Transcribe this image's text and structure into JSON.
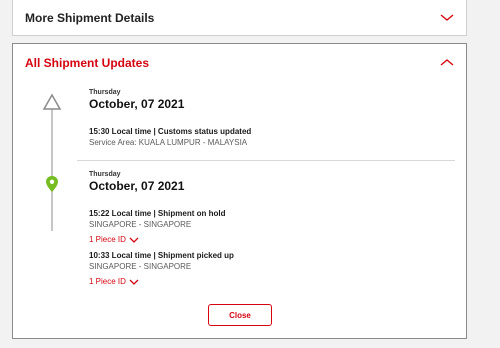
{
  "more_details": {
    "title": "More Shipment Details"
  },
  "updates": {
    "title": "All Shipment Updates",
    "groups": [
      {
        "day": "Thursday",
        "date": "October, 07 2021",
        "events": [
          {
            "time_status": "15:30 Local time  |  Customs status updated",
            "location": "Service Area: KUALA LUMPUR - MALAYSIA"
          }
        ]
      },
      {
        "day": "Thursday",
        "date": "October, 07 2021",
        "events": [
          {
            "time_status": "15:22 Local time  |  Shipment on hold",
            "location": "SINGAPORE - SINGAPORE",
            "piece_link": "1 Piece ID"
          },
          {
            "time_status": "10:33 Local time  |  Shipment picked up",
            "location": "SINGAPORE - SINGAPORE",
            "piece_link": "1 Piece ID"
          }
        ]
      }
    ],
    "close_label": "Close"
  },
  "colors": {
    "accent": "#d40511",
    "pin": "#76bd22",
    "line": "#c6c6c6"
  },
  "icons": {
    "expand": "chevron-down-icon",
    "collapse": "chevron-up-icon",
    "origin": "triangle-marker-icon",
    "current": "location-pin-icon"
  }
}
